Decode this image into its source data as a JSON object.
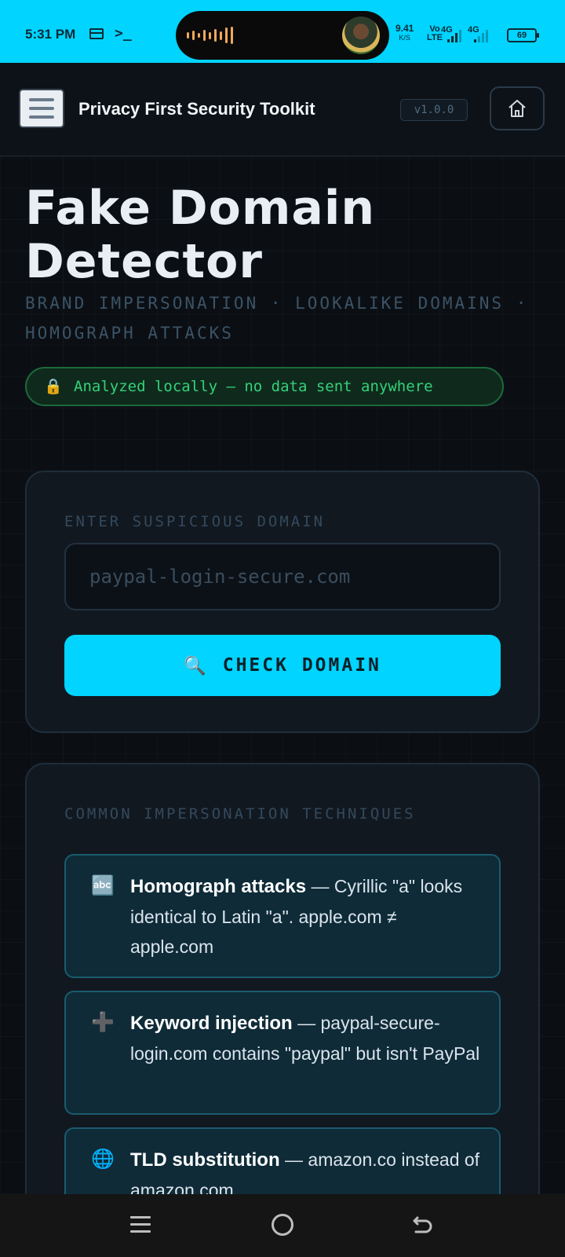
{
  "status_bar": {
    "time": "5:31 PM",
    "net_speed": "9.41",
    "net_speed_unit": "K/S",
    "volte_top": "Vo",
    "volte_bottom": "LTE",
    "sim1": "4G",
    "sim2": "4G",
    "battery": "69",
    "accent_color": "#00d4ff"
  },
  "header": {
    "menu_icon": "hamburger-icon",
    "title": "Privacy First Security Toolkit",
    "version": "v1.0.0",
    "home_icon": "home-icon"
  },
  "hero": {
    "title": "Fake Domain Detector",
    "subtitle": "BRAND IMPERSONATION · LOOKALIKE DOMAINS · HOMOGRAPH ATTACKS",
    "badge_icon": "🔒",
    "badge_text": "Analyzed locally — no data sent anywhere"
  },
  "checker": {
    "label": "ENTER SUSPICIOUS DOMAIN",
    "input_value": "",
    "input_placeholder": "paypal-login-secure.com",
    "button_icon": "🔍",
    "button_label": "CHECK DOMAIN"
  },
  "techniques": {
    "label": "COMMON IMPERSONATION TECHNIQUES",
    "items": [
      {
        "icon": "🔤",
        "title": "Homograph attacks",
        "text": " — Cyrillic \"а\" looks identical to Latin \"a\". аpple.com ≠ apple.com"
      },
      {
        "icon": "➕",
        "title": "Keyword injection",
        "text": " — paypal-secure-login.com contains \"paypal\" but isn't PayPal"
      },
      {
        "icon": "🌐",
        "title": "TLD substitution",
        "text": " — amazon.co instead of amazon.com"
      }
    ]
  },
  "nav": {
    "menu_icon": "recent-apps-icon",
    "home_icon": "home-circle-icon",
    "back_icon": "back-icon"
  }
}
